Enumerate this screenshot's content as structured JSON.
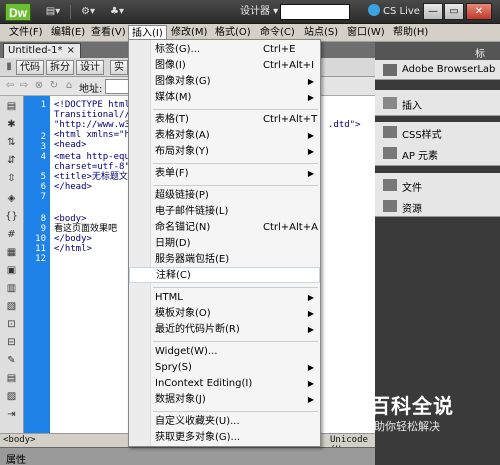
{
  "titlebar": {
    "logo": "Dw",
    "workspace": "设计器 ▾",
    "cslive": "CS Live",
    "win_min": "—",
    "win_max": "▭",
    "win_close": "✕"
  },
  "menubar": {
    "items": [
      "文件(F)",
      "编辑(E)",
      "查看(V)",
      "插入(I)",
      "修改(M)",
      "格式(O)",
      "命令(C)",
      "站点(S)",
      "窗口(W)",
      "帮助(H)"
    ]
  },
  "doc": {
    "tab_name": "Untitled-1*",
    "tab_close": "×",
    "view_code": "代码",
    "view_split": "拆分",
    "view_design": "设计",
    "view_live": "实",
    "address_label": "地址:",
    "status_tag": "<body>",
    "status_encoding": "Unicode (U",
    "properties_label": "属性"
  },
  "code": {
    "line_numbers": [
      "1",
      "2",
      "3",
      "4",
      "5",
      "6",
      "7",
      "8",
      "9",
      "10",
      "11",
      "12"
    ],
    "lines": [
      "<!DOCTYPE html",
      "Transitional//E",
      "\"http://www.w3.",
      "<html xmlns=\"ht",
      "<head>",
      "<meta http-equi",
      "charset=utf-8\"",
      "<title>无标题文档",
      "</head>",
      "",
      "<body>",
      "看这页面效果吧",
      "</body>",
      "</html>"
    ],
    "dtd_tail": ".dtd\">"
  },
  "insert_menu": {
    "items": [
      {
        "label": "标签(G)...",
        "shortcut": "Ctrl+E",
        "submenu": false
      },
      {
        "label": "图像(I)",
        "shortcut": "Ctrl+Alt+I",
        "submenu": false
      },
      {
        "label": "图像对象(G)",
        "shortcut": "",
        "submenu": true
      },
      {
        "label": "媒体(M)",
        "shortcut": "",
        "submenu": true
      },
      {
        "label": "表格(T)",
        "shortcut": "Ctrl+Alt+T",
        "submenu": false
      },
      {
        "label": "表格对象(A)",
        "shortcut": "",
        "submenu": true
      },
      {
        "label": "布局对象(Y)",
        "shortcut": "",
        "submenu": true
      },
      {
        "label": "表单(F)",
        "shortcut": "",
        "submenu": true
      },
      {
        "label": "超级链接(P)",
        "shortcut": "",
        "submenu": false
      },
      {
        "label": "电子邮件链接(L)",
        "shortcut": "",
        "submenu": false
      },
      {
        "label": "命名锚记(N)",
        "shortcut": "Ctrl+Alt+A",
        "submenu": false
      },
      {
        "label": "日期(D)",
        "shortcut": "",
        "submenu": false
      },
      {
        "label": "服务器端包括(E)",
        "shortcut": "",
        "submenu": false
      },
      {
        "label": "注释(C)",
        "shortcut": "",
        "submenu": false
      },
      {
        "label": "HTML",
        "shortcut": "",
        "submenu": true
      },
      {
        "label": "模板对象(O)",
        "shortcut": "",
        "submenu": true
      },
      {
        "label": "最近的代码片断(R)",
        "shortcut": "",
        "submenu": true
      },
      {
        "label": "Widget(W)...",
        "shortcut": "",
        "submenu": false
      },
      {
        "label": "Spry(S)",
        "shortcut": "",
        "submenu": true
      },
      {
        "label": "InContext Editing(I)",
        "shortcut": "",
        "submenu": true
      },
      {
        "label": "数据对象(J)",
        "shortcut": "",
        "submenu": true
      },
      {
        "label": "自定义收藏夹(U)...",
        "shortcut": "",
        "submenu": false
      },
      {
        "label": "获取更多对象(G)...",
        "shortcut": "",
        "submenu": false
      }
    ],
    "highlighted": "注释(C)"
  },
  "right_panel": {
    "browserlab": "Adobe BrowserLab",
    "insert": "插入",
    "css": "CSS样式",
    "ap": "AP 元素",
    "files": "文件",
    "assets": "资源",
    "top_tab": "标"
  },
  "watermark": {
    "title": "百科全说",
    "subtitle": "助你轻松解决"
  }
}
